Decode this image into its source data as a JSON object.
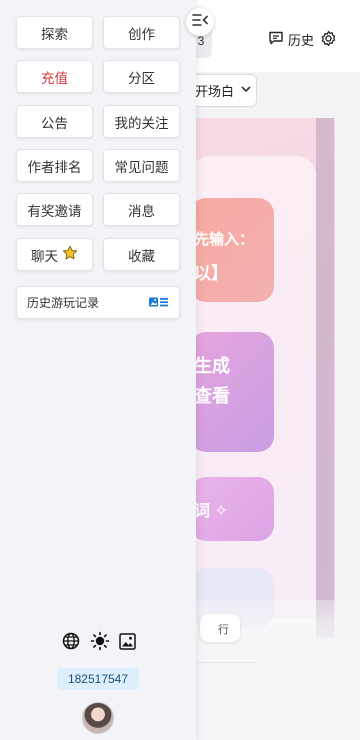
{
  "background": {
    "badge_number": "3",
    "history_label": "历史",
    "scene_select_value": "开场白",
    "card1_line1": "先输入：",
    "card1_line2": "以】",
    "card2_line1": "生成",
    "card2_line2": "查看",
    "card3_text": "词 ✧",
    "pill_text": "行"
  },
  "drawer": {
    "nav": [
      {
        "label": "探索"
      },
      {
        "label": "创作"
      },
      {
        "label": "充值"
      },
      {
        "label": "分区"
      },
      {
        "label": "公告"
      },
      {
        "label": "我的关注"
      },
      {
        "label": "作者排名"
      },
      {
        "label": "常见问题"
      },
      {
        "label": "有奖邀请"
      },
      {
        "label": "消息"
      },
      {
        "label": "聊天"
      },
      {
        "label": "收藏"
      }
    ],
    "history_record_label": "历史游玩记录",
    "user_id": "182517547",
    "accent_red": "#d9363e",
    "accent_blue": "#1e7ad6"
  }
}
